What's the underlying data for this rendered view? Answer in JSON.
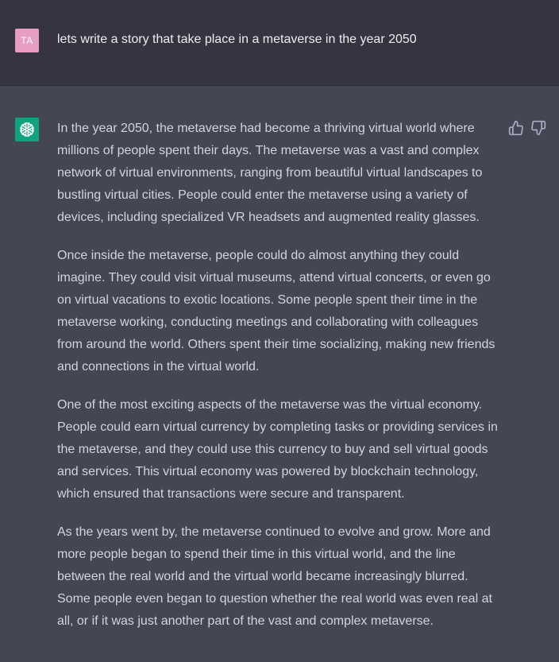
{
  "user_message": {
    "avatar_initials": "TA",
    "avatar_color": "#e59dc4",
    "text": "lets write a story that take place in a metaverse in the year 2050"
  },
  "assistant_message": {
    "avatar_icon": "openai-logo-icon",
    "avatar_color": "#10a37f",
    "paragraphs": [
      "In the year 2050, the metaverse had become a thriving virtual world where millions of people spent their days. The metaverse was a vast and complex network of virtual environments, ranging from beautiful virtual landscapes to bustling virtual cities. People could enter the metaverse using a variety of devices, including specialized VR headsets and augmented reality glasses.",
      "Once inside the metaverse, people could do almost anything they could imagine. They could visit virtual museums, attend virtual concerts, or even go on virtual vacations to exotic locations. Some people spent their time in the metaverse working, conducting meetings and collaborating with colleagues from around the world. Others spent their time socializing, making new friends and connections in the virtual world.",
      "One of the most exciting aspects of the metaverse was the virtual economy. People could earn virtual currency by completing tasks or providing services in the metaverse, and they could use this currency to buy and sell virtual goods and services. This virtual economy was powered by blockchain technology, which ensured that transactions were secure and transparent.",
      "As the years went by, the metaverse continued to evolve and grow. More and more people began to spend their time in this virtual world, and the line between the real world and the virtual world became increasingly blurred. Some people even began to question whether the real world was even real at all, or if it was just another part of the vast and complex metaverse."
    ],
    "feedback_icons": [
      "thumbs-up-icon",
      "thumbs-down-icon"
    ]
  },
  "colors": {
    "user_row_bg": "#343541",
    "assistant_row_bg": "#444654",
    "text": "#d1d5db"
  }
}
